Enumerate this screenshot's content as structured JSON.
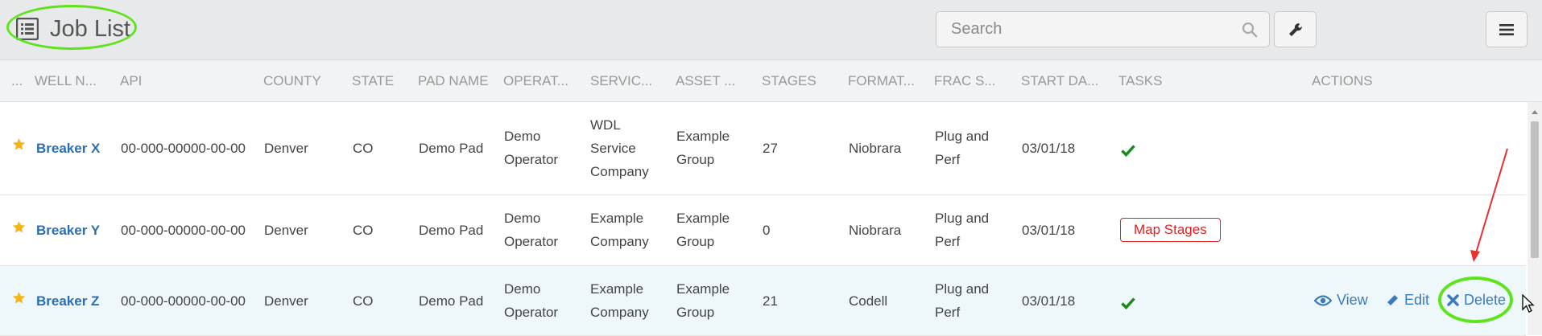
{
  "header": {
    "title": "Job List",
    "search_placeholder": "Search"
  },
  "columns": [
    "...",
    "WELL N...",
    "API",
    "COUNTY",
    "STATE",
    "PAD NAME",
    "OPERAT...",
    "SERVIC...",
    "ASSET ...",
    "STAGES",
    "FORMAT...",
    "FRAC S...",
    "START DA...",
    "TASKS",
    "ACTIONS"
  ],
  "rows": [
    {
      "well": "Breaker X",
      "api": "00-000-00000-00-00",
      "county": "Denver",
      "state": "CO",
      "pad": "Demo Pad",
      "operator": [
        "Demo",
        "Operator"
      ],
      "service": [
        "WDL",
        "Service",
        "Company"
      ],
      "asset": [
        "Example",
        "Group"
      ],
      "stages": "27",
      "formation": "Niobrara",
      "frac": [
        "Plug and",
        "Perf"
      ],
      "start": "03/01/18",
      "task": "check"
    },
    {
      "well": "Breaker Y",
      "api": "00-000-00000-00-00",
      "county": "Denver",
      "state": "CO",
      "pad": "Demo Pad",
      "operator": [
        "Demo",
        "Operator"
      ],
      "service": [
        "Example",
        "Company"
      ],
      "asset": [
        "Example",
        "Group"
      ],
      "stages": "0",
      "formation": "Niobrara",
      "frac": [
        "Plug and",
        "Perf"
      ],
      "start": "03/01/18",
      "task": "Map Stages"
    },
    {
      "well": "Breaker Z",
      "api": "00-000-00000-00-00",
      "county": "Denver",
      "state": "CO",
      "pad": "Demo Pad",
      "operator": [
        "Demo",
        "Operator"
      ],
      "service": [
        "Example",
        "Company"
      ],
      "asset": [
        "Example",
        "Group"
      ],
      "stages": "21",
      "formation": "Codell",
      "frac": [
        "Plug and",
        "Perf"
      ],
      "start": "03/01/18",
      "task": "check"
    }
  ],
  "actions": {
    "view": "View",
    "edit": "Edit",
    "delete": "Delete"
  },
  "colors": {
    "link": "#2a6fb5",
    "star": "#f5b41a",
    "check": "#1a8a1a",
    "badge": "#e02020",
    "highlight": "#5ee31c",
    "arrow": "#e83030"
  }
}
